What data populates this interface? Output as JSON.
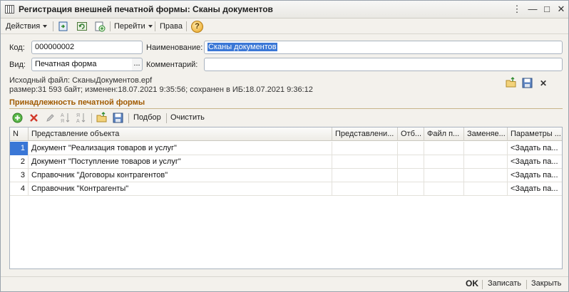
{
  "window": {
    "title": "Регистрация внешней печатной формы: Сканы документов",
    "controls": [
      "⋮",
      "—",
      "□",
      "✕"
    ]
  },
  "toolbar": {
    "actions_label": "Действия",
    "goto_label": "Перейти",
    "rights_label": "Права",
    "help_symbol": "?"
  },
  "form": {
    "code_label": "Код:",
    "code_value": "000000002",
    "name_label": "Наименование:",
    "name_value": "Сканы документов",
    "kind_label": "Вид:",
    "kind_value": "Печатная форма",
    "comment_label": "Комментарий:",
    "comment_value": "",
    "dots": "..."
  },
  "file_info": {
    "line1": "Исходный файл: СканыДокументов.epf",
    "line2": "размер:31 593 байт; изменен:18.07.2021 9:35:56; сохранен в ИБ:18.07.2021 9:36:12",
    "close_symbol": "✕"
  },
  "section": {
    "title": "Принадлежность печатной формы",
    "select_label": "Подбор",
    "clear_label": "Очистить"
  },
  "table": {
    "headers": [
      "N",
      "Представление объекта",
      "Представлени...",
      "Отб...",
      "Файл п...",
      "Заменяе...",
      "Параметры ..."
    ],
    "rows": [
      {
        "n": "1",
        "object": "Документ \"Реализация товаров и услуг\"",
        "params": "<Задать па..."
      },
      {
        "n": "2",
        "object": "Документ \"Поступление товаров и услуг\"",
        "params": "<Задать па..."
      },
      {
        "n": "3",
        "object": "Справочник \"Договоры контрагентов\"",
        "params": "<Задать па..."
      },
      {
        "n": "4",
        "object": "Справочник \"Контрагенты\"",
        "params": "<Задать па..."
      }
    ]
  },
  "footer": {
    "ok_label": "OK",
    "save_label": "Записать",
    "close_label": "Закрыть"
  },
  "colors": {
    "section_title": "#a05a00",
    "selection": "#3a77d6"
  }
}
